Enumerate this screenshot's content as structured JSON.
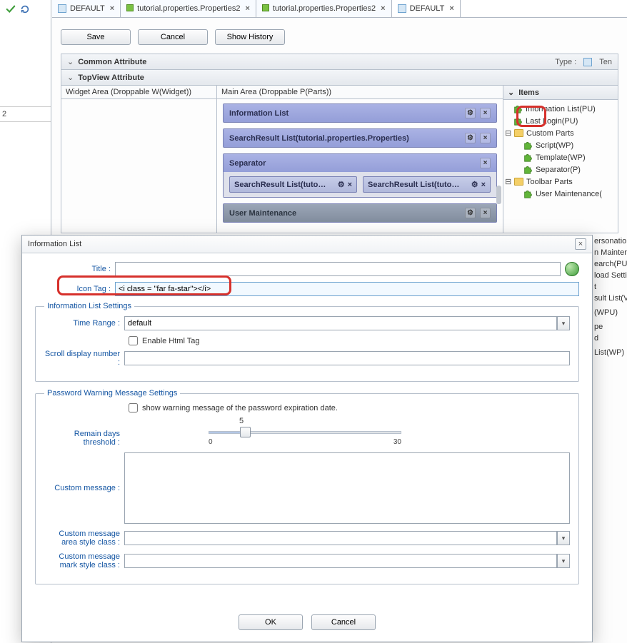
{
  "gutter": {
    "narrow_tab": "2"
  },
  "tabs": [
    {
      "label": "DEFAULT",
      "kind": "doc",
      "active": false
    },
    {
      "label": "tutorial.properties.Properties2",
      "kind": "box",
      "active": false
    },
    {
      "label": "tutorial.properties.Properties2",
      "kind": "box",
      "active": false
    },
    {
      "label": "DEFAULT",
      "kind": "doc",
      "active": true
    }
  ],
  "buttons": {
    "save": "Save",
    "cancel": "Cancel",
    "show_history": "Show History"
  },
  "sections": {
    "common_attr": "Common Attribute",
    "type_label": "Type :",
    "type_value": "Ten",
    "topview_attr": "TopView Attribute"
  },
  "workspace": {
    "widget_col": "Widget Area (Droppable W(Widget))",
    "main_col": "Main Area (Droppable P(Parts))",
    "parts": {
      "info_list": "Information List",
      "search_result": "SearchResult List(tutorial.properties.Properties)",
      "separator_title": "Separator",
      "sep_child_a": "SearchResult List(tuto…",
      "sep_child_b": "SearchResult List(tuto…",
      "user_maint": "User Maintenance"
    }
  },
  "items_panel": {
    "title": "Items",
    "items_top": [
      "Information List(PU)",
      "Last Login(PU)"
    ],
    "custom_parts_label": "Custom Parts",
    "custom_parts": [
      "Script(WP)",
      "Template(WP)",
      "Separator(P)"
    ],
    "toolbar_parts_label": "Toolbar Parts",
    "toolbar_parts": [
      "User Maintenance("
    ]
  },
  "cutoff_list": [
    "ersonation",
    "n Mainter",
    "earch(PU",
    "load Setti",
    "t",
    "sult List(V",
    "",
    "(WPU)",
    "",
    "pe",
    "d",
    "",
    "List(WP)"
  ],
  "dialog": {
    "title": "Information List",
    "field_title_label": "Title :",
    "field_title_value": "",
    "icon_tag_label": "Icon Tag :",
    "icon_tag_value": "<i class = \"far fa-star\"></i>",
    "group1_legend": "Information List Settings",
    "time_range_label": "Time Range :",
    "time_range_value": "default",
    "enable_html_label": "Enable Html Tag",
    "enable_html_checked": false,
    "scroll_display_label": "Scroll display number :",
    "scroll_display_value": "",
    "group2_legend": "Password Warning Message Settings",
    "show_warning_label": "show warning message of the password expiration date.",
    "show_warning_checked": false,
    "remain_days_label": "Remain days threshold :",
    "remain_days_value": "5",
    "slider_min": "0",
    "slider_max": "30",
    "custom_message_label": "Custom message :",
    "custom_message_value": "",
    "cm_area_style_label": "Custom message area style class :",
    "cm_area_style_value": "",
    "cm_mark_style_label": "Custom message mark style class :",
    "cm_mark_style_value": "",
    "ok": "OK",
    "cancel": "Cancel"
  }
}
